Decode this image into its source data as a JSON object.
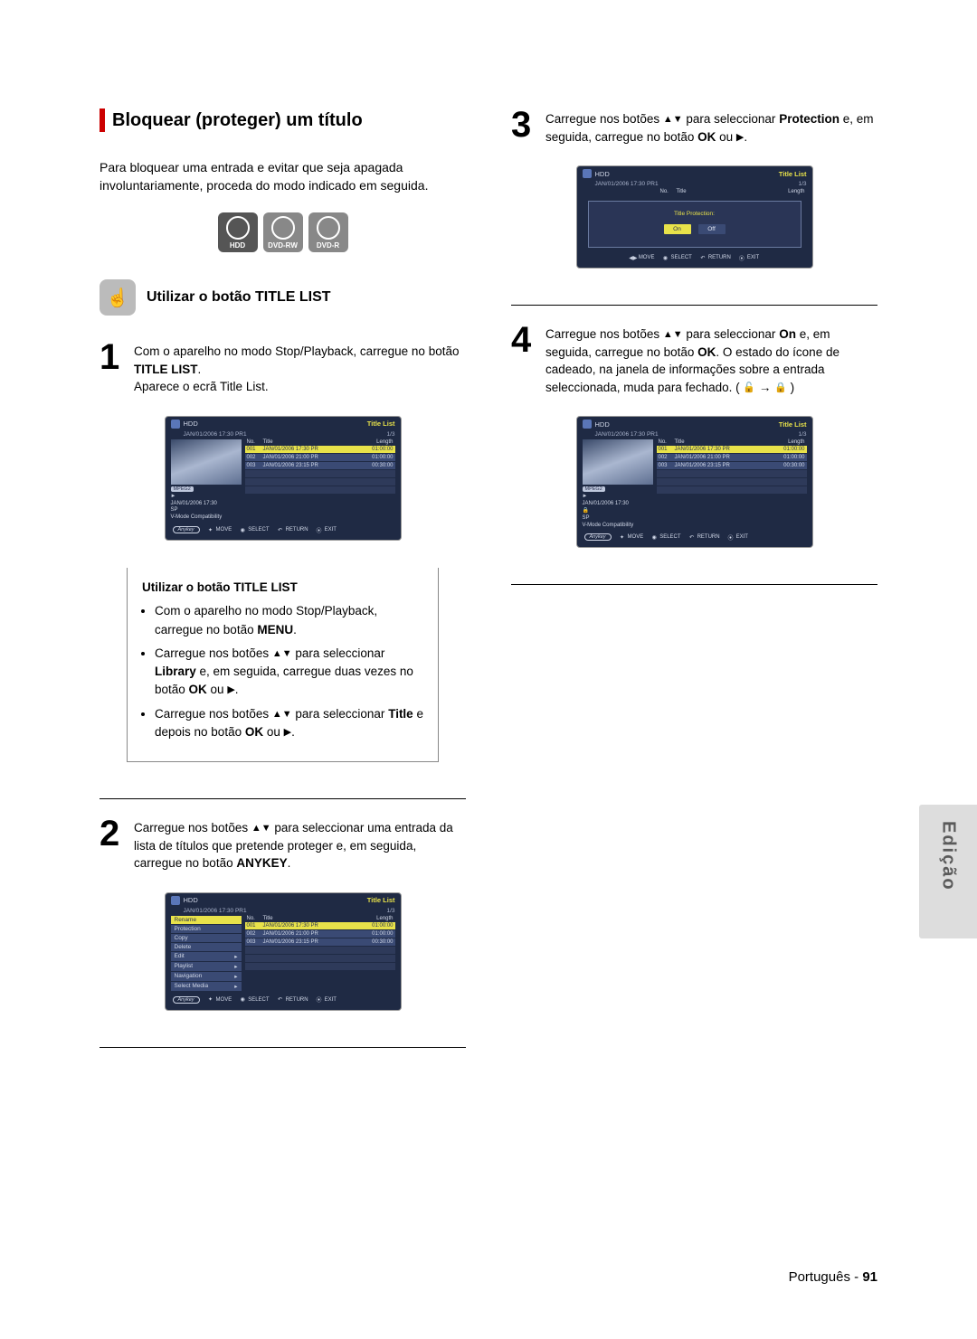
{
  "header": {
    "title": "Bloquear (proteger) um título"
  },
  "intro": "Para bloquear uma entrada e evitar que seja apagada involuntariamente, proceda do modo indicado em seguida.",
  "disc_labels": {
    "hdd": "HDD",
    "rw": "DVD-RW",
    "r": "DVD-R"
  },
  "subheading": "Utilizar o botão TITLE LIST",
  "steps": {
    "s1": {
      "num": "1",
      "line1": "Com o aparelho no modo Stop/Playback, carregue no botão ",
      "bold1": "TITLE LIST",
      "line2": ".",
      "after": "Aparece o ecrã Title List."
    },
    "s2": {
      "num": "2",
      "line1": "Carregue nos botões ",
      "line2": " para seleccionar uma entrada da lista de títulos que pretende proteger e, em seguida, carregue no botão ",
      "bold1": "ANYKEY",
      "line3": "."
    },
    "s3": {
      "num": "3",
      "line1": "Carregue nos botões ",
      "line2": " para seleccionar ",
      "bold1": "Protection",
      "line3": " e, em seguida, carregue no botão ",
      "bold2": "OK",
      "line4": " ou "
    },
    "s4": {
      "num": "4",
      "line1": "Carregue nos botões ",
      "line2": " para seleccionar ",
      "bold1": "On",
      "line3": " e, em seguida, carregue no botão ",
      "bold2": "OK",
      "line4": ". O estado do ícone de cadeado, na janela de informações sobre a entrada seleccionada, muda para fechado. ( "
    }
  },
  "inset": {
    "title": "Utilizar o botão TITLE LIST",
    "b1a": "Com o aparelho no modo Stop/Playback, carregue no botão ",
    "b1b": "MENU",
    "b1c": ".",
    "b2a": "Carregue nos botões ",
    "b2b": " para seleccionar ",
    "b2c": "Library",
    "b2d": " e, em seguida, carregue duas vezes no botão ",
    "b2e": "OK",
    "b2f": " ou ",
    "b3a": "Carregue nos botões ",
    "b3b": " para seleccionar ",
    "b3c": "Title",
    "b3d": " e depois no botão ",
    "b3e": "OK",
    "b3f": " ou "
  },
  "osd": {
    "hdd": "HDD",
    "titlelist": "Title List",
    "dateline": "JAN/01/2006 17:30 PR1",
    "page": "1/3",
    "cols": {
      "no": "No.",
      "title": "Title",
      "length": "Length"
    },
    "rows": [
      {
        "no": "001",
        "title": "JAN/01/2006 17:30 PR",
        "len": "01:00:00"
      },
      {
        "no": "002",
        "title": "JAN/01/2006 21:00 PR",
        "len": "01:00:00"
      },
      {
        "no": "003",
        "title": "JAN/01/2006 23:15 PR",
        "len": "00:30:00"
      }
    ],
    "meta": {
      "chip": "MPEG2",
      "date": "JAN/01/2006 17:30",
      "sp": "SP",
      "vmode": "V-Mode Compatibility"
    },
    "menu": [
      "Rename",
      "Protection",
      "Copy",
      "Delete",
      "Edit",
      "Playlist",
      "Navigation",
      "Select Media"
    ],
    "protect_label": "Title Protection:",
    "on": "On",
    "off": "Off",
    "foot": {
      "anykey": "Anykey",
      "move": "MOVE",
      "select": "SELECT",
      "return": "RETURN",
      "exit": "EXIT"
    }
  },
  "footer": {
    "lang": "Português",
    "sep": " - ",
    "page": "91"
  },
  "sidetab": "Edição"
}
